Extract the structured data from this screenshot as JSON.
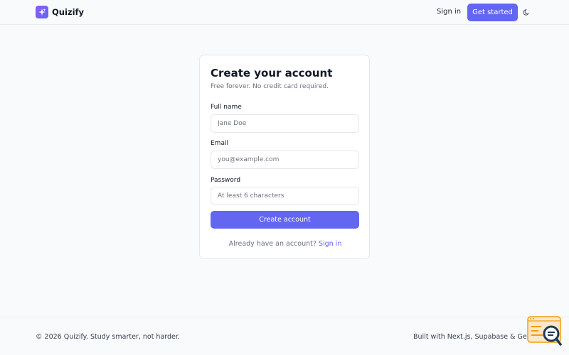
{
  "header": {
    "brand_name": "Quizify",
    "sign_in_label": "Sign in",
    "get_started_label": "Get started"
  },
  "icons": {
    "logo": "sparkles-icon",
    "theme_toggle": "moon-icon",
    "corner_widget": "search-magnifier-icon"
  },
  "colors": {
    "accent": "#6366f1",
    "background": "#f9fafb",
    "card": "#ffffff",
    "widget_orange": "#f59e0b"
  },
  "signup": {
    "title": "Create your account",
    "subtitle": "Free forever. No credit card required.",
    "full_name_label": "Full name",
    "full_name_placeholder": "Jane Doe",
    "full_name_value": "",
    "email_label": "Email",
    "email_placeholder": "you@example.com",
    "email_value": "",
    "password_label": "Password",
    "password_placeholder": "At least 6 characters",
    "password_value": "",
    "submit_label": "Create account",
    "footer_prompt": "Already have an account?",
    "footer_link": "Sign in"
  },
  "footer": {
    "copyright": "© 2026 Quizify. Study smarter, not harder.",
    "built_with": "Built with Next.js, Supabase & Gemini."
  }
}
